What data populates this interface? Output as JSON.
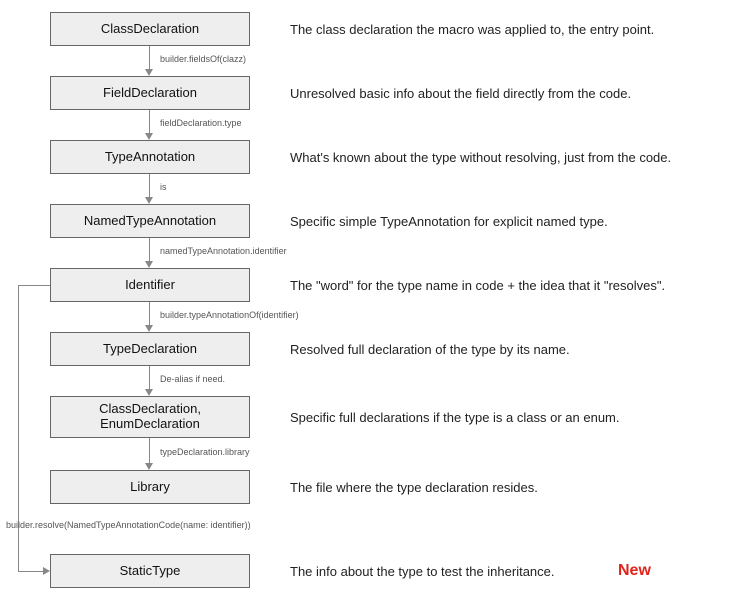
{
  "chart_data": {
    "type": "diagram",
    "nodes": [
      {
        "id": "class-declaration",
        "label": "ClassDeclaration",
        "description": "The class declaration the macro was applied to, the entry point."
      },
      {
        "id": "field-declaration",
        "label": "FieldDeclaration",
        "description": "Unresolved basic info about the field directly from the code."
      },
      {
        "id": "type-annotation",
        "label": "TypeAnnotation",
        "description": "What's known about the type without resolving, just from the code."
      },
      {
        "id": "named-type-annotation",
        "label": "NamedTypeAnnotation",
        "description": "Specific simple TypeAnnotation for explicit named type."
      },
      {
        "id": "identifier",
        "label": "Identifier",
        "description": "The \"word\" for the type name in code + the idea that it \"resolves\"."
      },
      {
        "id": "type-declaration",
        "label": "TypeDeclaration",
        "description": "Resolved full declaration of the type by its name."
      },
      {
        "id": "class-enum-declaration",
        "label": "ClassDeclaration,\nEnumDeclaration",
        "description": "Specific full declarations if the type is a class or an enum."
      },
      {
        "id": "library",
        "label": "Library",
        "description": "The file where the type declaration resides."
      },
      {
        "id": "static-type",
        "label": "StaticType",
        "description": "The info about the type to test the inheritance."
      }
    ],
    "edges": [
      {
        "from": "class-declaration",
        "to": "field-declaration",
        "label": "builder.fieldsOf(clazz)"
      },
      {
        "from": "field-declaration",
        "to": "type-annotation",
        "label": "fieldDeclaration.type"
      },
      {
        "from": "type-annotation",
        "to": "named-type-annotation",
        "label": "is"
      },
      {
        "from": "named-type-annotation",
        "to": "identifier",
        "label": "namedTypeAnnotation.identifier"
      },
      {
        "from": "identifier",
        "to": "type-declaration",
        "label": "builder.typeAnnotationOf(identifier)"
      },
      {
        "from": "type-declaration",
        "to": "class-enum-declaration",
        "label": "De-alias if need."
      },
      {
        "from": "class-enum-declaration",
        "to": "library",
        "label": "typeDeclaration.library"
      },
      {
        "from": "identifier",
        "to": "static-type",
        "label": "builder.resolve(NamedTypeAnnotationCode(name: identifier))",
        "side": true
      }
    ],
    "badges": {
      "new": "New"
    }
  }
}
